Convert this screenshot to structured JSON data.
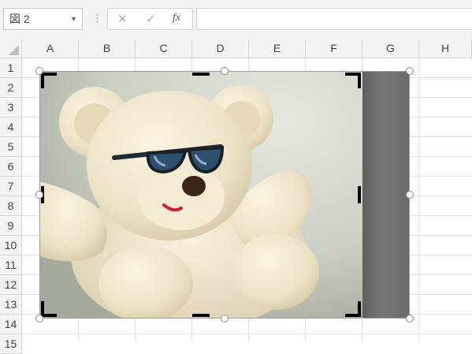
{
  "formula_bar": {
    "name_box": "図 2",
    "cancel_icon": "✕",
    "enter_icon": "✓",
    "function_icon": "fx",
    "formula": ""
  },
  "columns": [
    "A",
    "B",
    "C",
    "D",
    "E",
    "F",
    "G",
    "H"
  ],
  "rows": [
    "1",
    "2",
    "3",
    "4",
    "5",
    "6",
    "7",
    "8",
    "9",
    "10",
    "11",
    "12",
    "13",
    "14",
    "15"
  ],
  "picture": {
    "subject": "teddy-bear-with-sunglasses",
    "mode": "crop",
    "cropped_area_color": "#6b6b6b"
  }
}
